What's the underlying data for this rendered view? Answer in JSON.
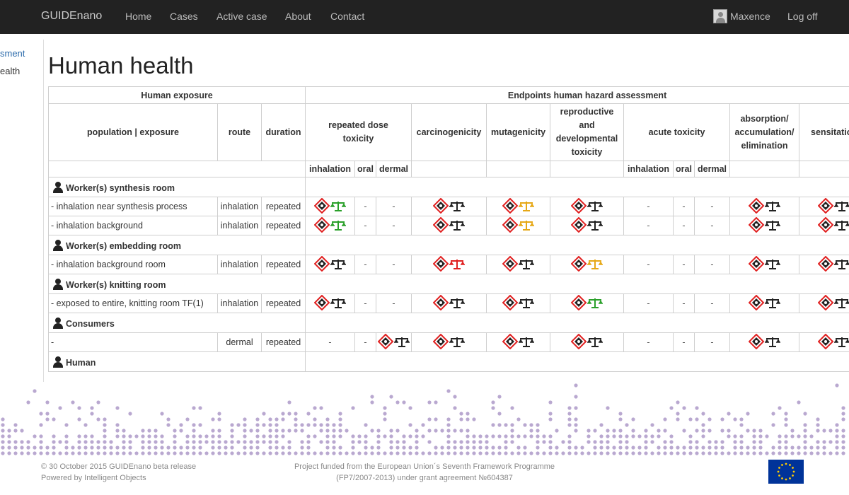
{
  "nav": {
    "brand": "GUIDEnano",
    "links": [
      "Home",
      "Cases",
      "Active case",
      "About",
      "Contact"
    ],
    "user": "Maxence",
    "logoff": "Log off"
  },
  "sidebar": {
    "items": [
      "sment",
      "ealth"
    ]
  },
  "page_title": "Human health",
  "table": {
    "human_exposure": "Human exposure",
    "endpoints": "Endpoints human hazard assessment",
    "col_population": "population | exposure",
    "col_route": "route",
    "col_duration": "duration",
    "ep_repeated": "repeated dose toxicity",
    "ep_carcino": "carcinogenicity",
    "ep_mutagen": "mutagenicity",
    "ep_repro": "reproductive and developmental toxicity",
    "ep_acute": "acute toxicity",
    "ep_absorption": "absorption/ accumulation/ elimination",
    "ep_sensitation": "sensitation",
    "sub_inhalation": "inhalation",
    "sub_oral": "oral",
    "sub_dermal": "dermal",
    "dash": "-",
    "groups": [
      {
        "name": "Worker(s) synthesis room",
        "rows": [
          {
            "population": "- inhalation near synthesis process",
            "route": "inhalation",
            "duration": "repeated",
            "cells": [
              "g",
              "-",
              "-",
              "k",
              "o",
              "k",
              "-",
              "-",
              "-",
              "k",
              "k"
            ]
          },
          {
            "population": "- inhalation background",
            "route": "inhalation",
            "duration": "repeated",
            "cells": [
              "g",
              "-",
              "-",
              "k",
              "o",
              "k",
              "-",
              "-",
              "-",
              "k",
              "k"
            ]
          }
        ]
      },
      {
        "name": "Worker(s) embedding room",
        "rows": [
          {
            "population": "- inhalation background room",
            "route": "inhalation",
            "duration": "repeated",
            "cells": [
              "k",
              "-",
              "-",
              "r",
              "k",
              "o",
              "-",
              "-",
              "-",
              "k",
              "k"
            ]
          }
        ]
      },
      {
        "name": "Worker(s) knitting room",
        "rows": [
          {
            "population": "- exposed to entire, knitting room TF(1)",
            "route": "inhalation",
            "duration": "repeated",
            "cells": [
              "k",
              "-",
              "-",
              "k",
              "k",
              "g",
              "-",
              "-",
              "-",
              "k",
              "k"
            ]
          }
        ]
      },
      {
        "name": "Consumers",
        "rows": [
          {
            "population": "-",
            "route": "dermal",
            "duration": "repeated",
            "cells": [
              "-",
              "-",
              "k",
              "k",
              "k",
              "k",
              "-",
              "-",
              "-",
              "k",
              "k"
            ]
          }
        ]
      },
      {
        "name": "Human",
        "rows": []
      }
    ]
  },
  "scale_colors": {
    "k": "#222222",
    "g": "#2aa02a",
    "o": "#e6a817",
    "r": "#e02020"
  },
  "hazard_diamond_color": "#e02020",
  "footer": {
    "line1": "© 30 October 2015 GUIDEnano beta release",
    "line2": "Powered by Intelligent Objects",
    "project1": "Project funded from the European Union´s Seventh Framework Programme",
    "project2": "(FP7/2007-2013) under grant agreement №604387"
  },
  "dot_color": "#b9a8d0"
}
